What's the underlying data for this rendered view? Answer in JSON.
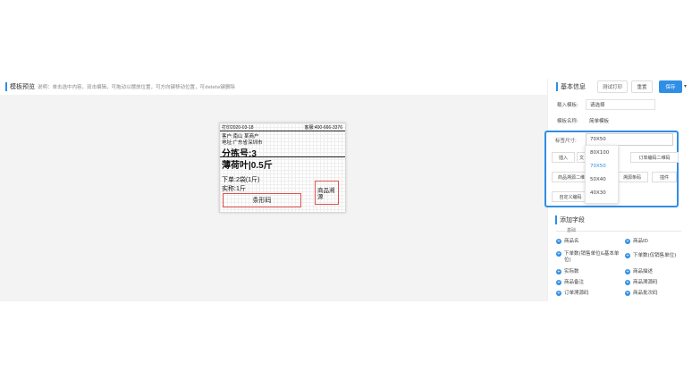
{
  "left": {
    "title": "模板预览",
    "hint": "说明：单击选中内容，双击编辑，可拖动以摆放位置，可方向键移动位置，可delete键删除"
  },
  "label": {
    "date": "打印2020-03-18",
    "phone": "客服:400-666-3376",
    "customer": "客户:南山 某商户",
    "address": "地址:广东省深圳市",
    "sort_no": "分拣号:3",
    "product": "薄荷叶|0.5斤",
    "order_qty": "下单:2袋(1斤)",
    "actual_qty": "实称:1斤",
    "barcode": "条形码",
    "source": "商品溯源"
  },
  "panel": {
    "title": "基本信息",
    "btn_test": "测试打印",
    "btn_reset": "重置",
    "btn_save": "保存",
    "import_label": "载入模板:",
    "import_value": "请选择",
    "name_label": "模板名称:",
    "name_value": "简单模板",
    "size_label": "标签尺寸:",
    "size_value": "70X50",
    "mini_1": "插入",
    "mini_2": "文",
    "mini_3": "订单编码二维码",
    "mini_4": "商品溯源二维",
    "mini_5": "溯源条码",
    "mini_6": "插件",
    "mini_7": "自定义编码",
    "options": [
      "80X100",
      "70X50",
      "50X40",
      "40X30"
    ]
  },
  "fields": {
    "title": "添加字段",
    "group": "基础",
    "items_a": [
      "商品名",
      "下单数(销售单位&基本单位)",
      "实际数",
      "商品备注",
      "订单溯源码"
    ],
    "items_b": [
      "商品ID",
      "下单数(仅销售单位)",
      "商品描述",
      "商品溯源码",
      "商品批次码"
    ]
  }
}
